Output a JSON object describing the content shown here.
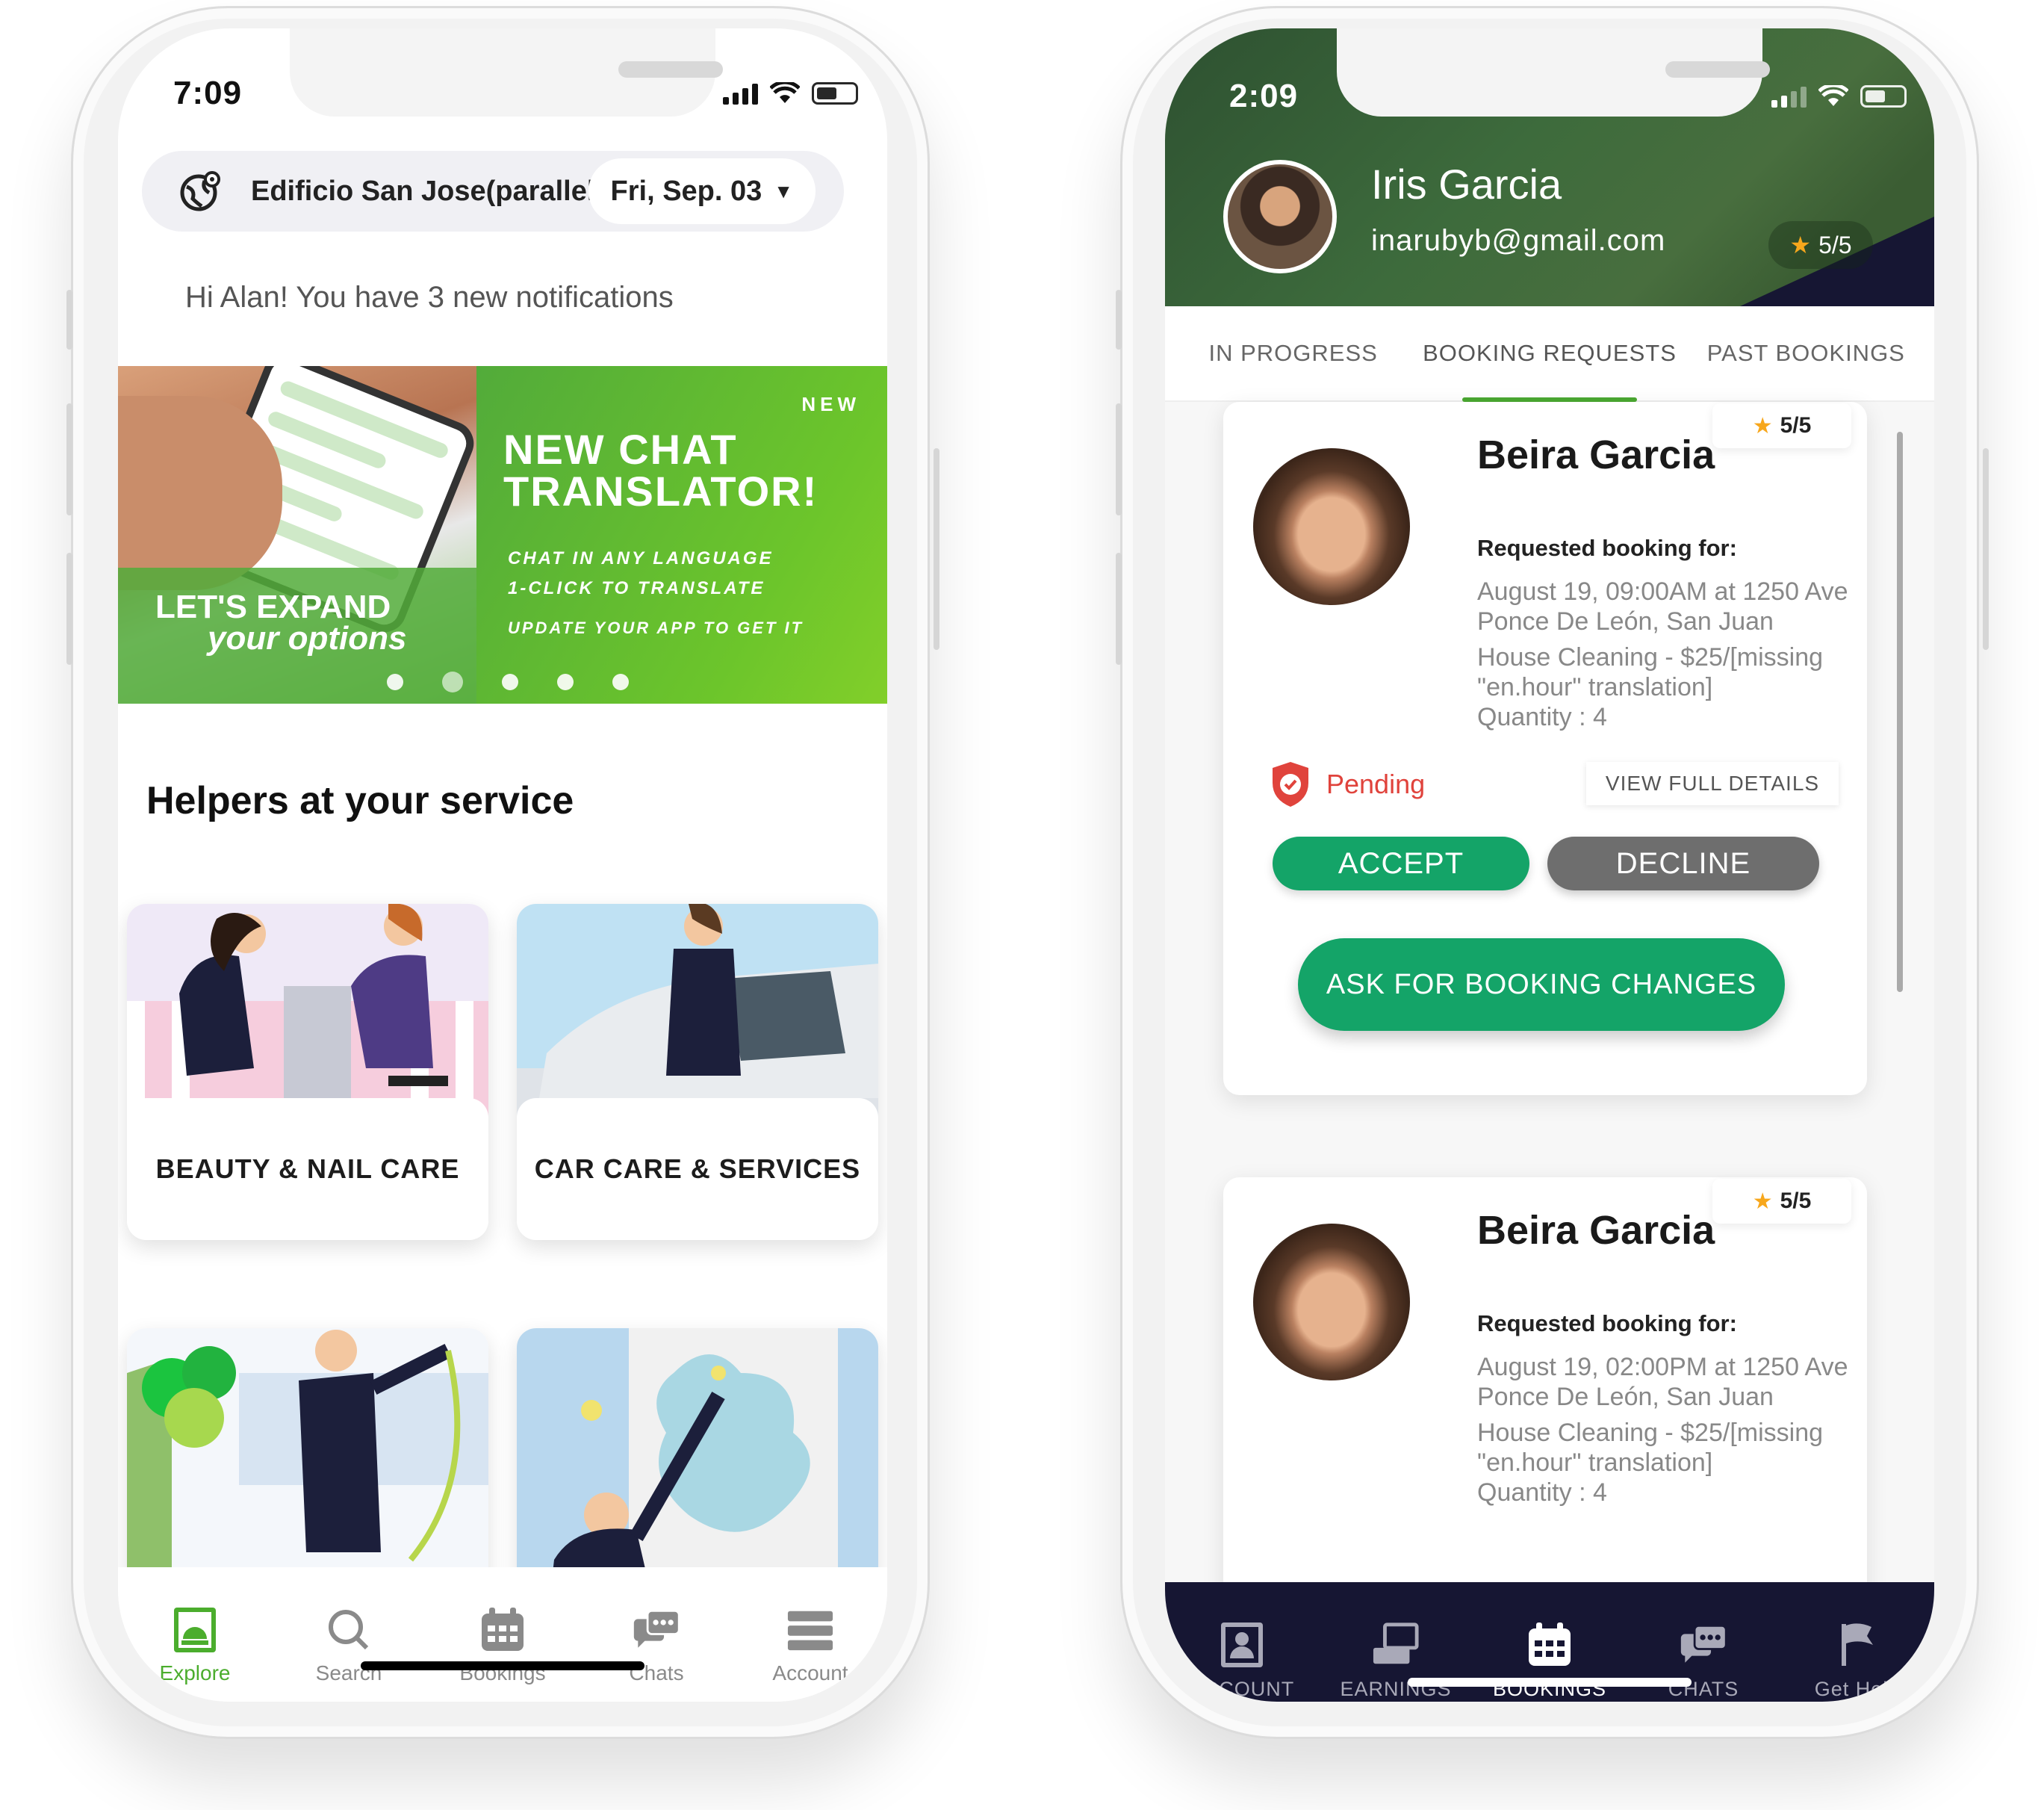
{
  "left_screen": {
    "status": {
      "time": "7:09"
    },
    "location": {
      "text": "Edificio San Jose(parallel to...",
      "date": "Fri, Sep. 03"
    },
    "notification": "Hi Alan! You have 3 new notifications",
    "banner": {
      "new_tag": "NEW",
      "title": "NEW CHAT TRANSLATOR!",
      "line1": "CHAT IN ANY LANGUAGE",
      "line2": "1-CLICK TO TRANSLATE",
      "line3": "UPDATE YOUR APP TO GET IT",
      "left_line1": "LET'S EXPAND",
      "left_line2": "your options",
      "page_count": 5,
      "active_page": 2
    },
    "section_title": "Helpers at your service",
    "categories": [
      {
        "label": "BEAUTY & NAIL CARE"
      },
      {
        "label": "CAR CARE & SERVICES"
      }
    ],
    "tabbar": [
      {
        "label": "Explore",
        "icon": "explore-icon",
        "active": true
      },
      {
        "label": "Search",
        "icon": "search-icon"
      },
      {
        "label": "Bookings",
        "icon": "calendar-icon"
      },
      {
        "label": "Chats",
        "icon": "chat-icon"
      },
      {
        "label": "Account",
        "icon": "account-icon"
      }
    ],
    "colors": {
      "accent": "#4bad2d"
    }
  },
  "right_screen": {
    "status": {
      "time": "2:09"
    },
    "profile": {
      "name": "Iris Garcia",
      "email": "inarubyb@gmail.com",
      "rating": "5/5"
    },
    "tabs": [
      {
        "label": "IN PROGRESS"
      },
      {
        "label": "BOOKING REQUESTS",
        "active": true
      },
      {
        "label": "PAST BOOKINGS"
      }
    ],
    "bookings": [
      {
        "name": "Beira Garcia",
        "rating": "5/5",
        "requested_label": "Requested booking for:",
        "when_where": "August 19, 09:00AM at 1250 Ave Ponce De León, San Juan",
        "service": "House Cleaning - $25/[missing \"en.hour\" translation]",
        "quantity": "Quantity : 4",
        "status": "Pending",
        "details_label": "VIEW FULL DETAILS",
        "accept_label": "ACCEPT",
        "decline_label": "DECLINE",
        "ask_label": "ASK FOR BOOKING CHANGES"
      },
      {
        "name": "Beira Garcia",
        "rating": "5/5",
        "requested_label": "Requested booking for:",
        "when_where": "August 19, 02:00PM at 1250 Ave Ponce De León, San Juan",
        "service": "House Cleaning - $25/[missing \"en.hour\" translation]",
        "quantity": "Quantity : 4"
      }
    ],
    "tabbar": [
      {
        "label": "ACCOUNT",
        "icon": "account-icon"
      },
      {
        "label": "EARNINGS",
        "icon": "earnings-icon"
      },
      {
        "label": "BOOKINGS",
        "icon": "calendar-icon",
        "active": true
      },
      {
        "label": "CHATS",
        "icon": "chat-icon"
      },
      {
        "label": "Get Help",
        "icon": "flag-icon"
      }
    ],
    "colors": {
      "header": "#3d6b3c",
      "primary": "#14a468",
      "tabbar": "#161633",
      "pending": "#e0433c"
    }
  }
}
